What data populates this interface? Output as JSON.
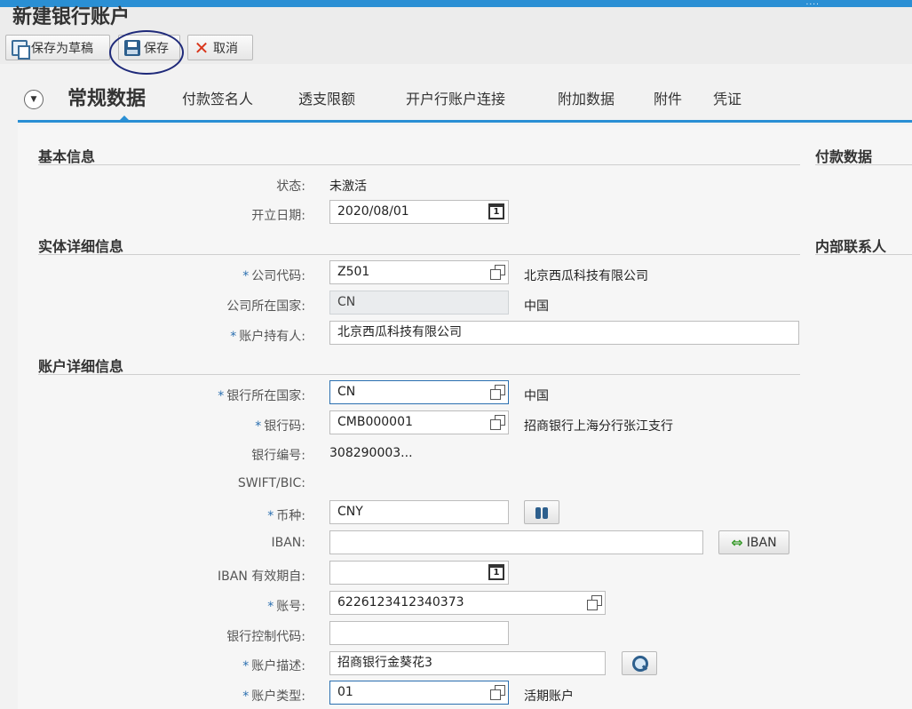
{
  "window": {
    "title": "新建银行账户",
    "top_dots": "....",
    "toolbar": {
      "save_draft": "保存为草稿",
      "save": "保存",
      "cancel": "取消"
    }
  },
  "tabs": [
    {
      "label": "常规数据",
      "active": true
    },
    {
      "label": "付款签名人"
    },
    {
      "label": "透支限额"
    },
    {
      "label": "开户行账户连接"
    },
    {
      "label": "附加数据"
    },
    {
      "label": "附件"
    },
    {
      "label": "凭证"
    }
  ],
  "sections": {
    "basic": "基本信息",
    "entity": "实体详细信息",
    "account": "账户详细信息",
    "payment": "付款数据",
    "internal_contact": "内部联系人"
  },
  "fields": {
    "status": {
      "label": "状态:",
      "value": "未激活"
    },
    "open_date": {
      "label": "开立日期:",
      "value": "2020/08/01"
    },
    "company_code": {
      "label": "公司代码:",
      "value": "Z501",
      "desc": "北京西瓜科技有限公司"
    },
    "company_country": {
      "label": "公司所在国家:",
      "value": "CN",
      "desc": "中国"
    },
    "account_holder": {
      "label": "账户持有人:",
      "value": "北京西瓜科技有限公司"
    },
    "bank_country": {
      "label": "银行所在国家:",
      "value": "CN",
      "desc": "中国"
    },
    "bank_key": {
      "label": "银行码:",
      "value": "CMB000001",
      "desc": "招商银行上海分行张江支行"
    },
    "bank_number": {
      "label": "银行编号:",
      "value": "308290003..."
    },
    "swift": {
      "label": "SWIFT/BIC:",
      "value": ""
    },
    "currency": {
      "label": "币种:",
      "value": "CNY"
    },
    "iban": {
      "label": "IBAN:",
      "value": "",
      "button": "IBAN"
    },
    "iban_valid_from": {
      "label": "IBAN 有效期自:",
      "value": ""
    },
    "account_number": {
      "label": "账号:",
      "value": "6226123412340373"
    },
    "bank_control_key": {
      "label": "银行控制代码:",
      "value": ""
    },
    "account_desc": {
      "label": "账户描述:",
      "value": "招商银行金葵花3"
    },
    "account_type": {
      "label": "账户类型:",
      "value": "01",
      "desc": "活期账户"
    }
  },
  "required_marker": "*",
  "calendar_day": "1",
  "icons": {
    "toggle": "chevron-down-icon",
    "value_help": "value-help-icon",
    "calendar": "calendar-icon",
    "binoculars": "binoculars-icon",
    "iban_convert": "double-arrow-icon",
    "search": "magnifier-icon"
  },
  "colors": {
    "accent": "#2a8fd4",
    "required": "#2a6fb0",
    "highlight_ring": "#1f2a7a",
    "cancel": "#d9361b"
  }
}
